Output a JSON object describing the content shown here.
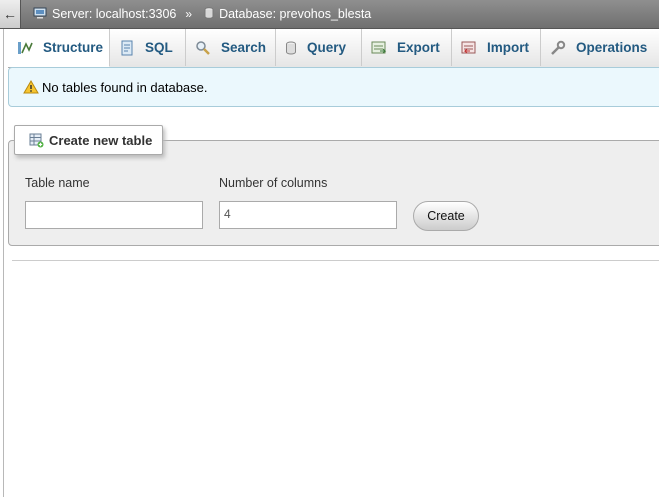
{
  "breadcrumb": {
    "back_label": "←",
    "server": "Server: localhost:3306",
    "separator": "»",
    "database": "Database: prevohos_blesta"
  },
  "tabs": [
    {
      "label": "Structure",
      "icon": "structure-icon",
      "active": true
    },
    {
      "label": "SQL",
      "icon": "sql-icon",
      "active": false
    },
    {
      "label": "Search",
      "icon": "search-icon",
      "active": false
    },
    {
      "label": "Query",
      "icon": "query-icon",
      "active": false
    },
    {
      "label": "Export",
      "icon": "export-icon",
      "active": false
    },
    {
      "label": "Import",
      "icon": "import-icon",
      "active": false
    },
    {
      "label": "Operations",
      "icon": "wrench-icon",
      "active": false
    }
  ],
  "notice": {
    "text": "No tables found in database.",
    "icon": "warning-icon"
  },
  "create_table": {
    "legend": "Create new table",
    "table_name_label": "Table name",
    "table_name_value": "",
    "columns_label": "Number of columns",
    "columns_value": "4",
    "create_button": "Create"
  },
  "colors": {
    "tab_text": "#235a81",
    "notice_bg": "#ebf8fd",
    "panel_bg": "#eeeeee"
  }
}
